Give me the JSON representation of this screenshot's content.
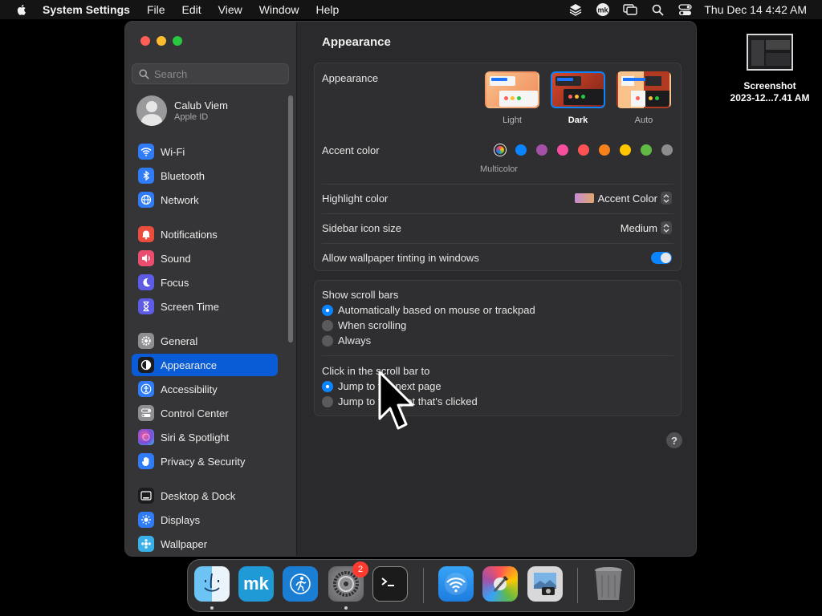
{
  "menubar": {
    "apple_icon": "apple-logo",
    "app_name": "System Settings",
    "items": [
      "File",
      "Edit",
      "View",
      "Window",
      "Help"
    ],
    "clock": "Thu Dec 14  4:42 AM",
    "status_icons": [
      "layers-icon",
      "mk-icon",
      "screen-mirroring-icon",
      "search-icon",
      "control-center-icon"
    ]
  },
  "desktop": {
    "file_name_line1": "Screenshot",
    "file_name_line2": "2023-12...7.41 AM"
  },
  "sidebar": {
    "search_placeholder": "Search",
    "user": {
      "name": "Calub Viem",
      "subtitle": "Apple ID"
    },
    "items": [
      {
        "label": "Wi-Fi",
        "icon": "wifi-icon",
        "color": "#2f7cf6"
      },
      {
        "label": "Bluetooth",
        "icon": "bluetooth-icon",
        "color": "#2f7cf6"
      },
      {
        "label": "Network",
        "icon": "globe-icon",
        "color": "#2f7cf6"
      },
      {
        "label": "Notifications",
        "icon": "bell-icon",
        "color": "#eb4d3d"
      },
      {
        "label": "Sound",
        "icon": "speaker-icon",
        "color": "#eb4d6e"
      },
      {
        "label": "Focus",
        "icon": "moon-icon",
        "color": "#5e5ce6"
      },
      {
        "label": "Screen Time",
        "icon": "hourglass-icon",
        "color": "#5e5ce6"
      },
      {
        "label": "General",
        "icon": "gear-icon",
        "color": "#8e8e93"
      },
      {
        "label": "Appearance",
        "icon": "appearance-icon",
        "color": "#1c1c1e"
      },
      {
        "label": "Accessibility",
        "icon": "accessibility-icon",
        "color": "#2f7cf6"
      },
      {
        "label": "Control Center",
        "icon": "control-center-icon",
        "color": "#8e8e93"
      },
      {
        "label": "Siri & Spotlight",
        "icon": "siri-icon",
        "color": "#7a4ddb"
      },
      {
        "label": "Privacy & Security",
        "icon": "hand-icon",
        "color": "#2f7cf6"
      },
      {
        "label": "Desktop & Dock",
        "icon": "dock-icon",
        "color": "#1c1c1e"
      },
      {
        "label": "Displays",
        "icon": "sun-icon",
        "color": "#2f7cf6"
      },
      {
        "label": "Wallpaper",
        "icon": "wallpaper-icon",
        "color": "#3ab0e8"
      }
    ],
    "selected": "Appearance"
  },
  "content": {
    "title": "Appearance",
    "appearance": {
      "label": "Appearance",
      "options": [
        "Light",
        "Dark",
        "Auto"
      ],
      "selected": "Dark"
    },
    "accent": {
      "label": "Accent color",
      "multicolor_label": "Multicolor",
      "colors": [
        "#ffffff",
        "#0a84ff",
        "#a550a7",
        "#f74f9e",
        "#ff5257",
        "#f7821b",
        "#ffc600",
        "#62ba46",
        "#8c8c8c"
      ]
    },
    "highlight": {
      "label": "Highlight color",
      "value": "Accent Color"
    },
    "sidebar_icon_size": {
      "label": "Sidebar icon size",
      "value": "Medium"
    },
    "wallpaper_tinting": {
      "label": "Allow wallpaper tinting in windows",
      "on": true
    },
    "scroll_bars": {
      "label": "Show scroll bars",
      "options": [
        "Automatically based on mouse or trackpad",
        "When scrolling",
        "Always"
      ],
      "selected": 0
    },
    "click_scroll": {
      "label": "Click in the scroll bar to",
      "options": [
        "Jump to the next page",
        "Jump to the spot that's clicked"
      ],
      "selected": 0
    },
    "help_label": "?"
  },
  "dock": {
    "apps": [
      {
        "name": "Finder",
        "icon": "finder-icon",
        "running": true
      },
      {
        "name": "mk",
        "icon": "mk-app-icon",
        "running": false
      },
      {
        "name": "Fitness",
        "icon": "runner-icon",
        "running": false
      },
      {
        "name": "System Settings",
        "icon": "settings-gear-icon",
        "running": true,
        "badge": "2"
      },
      {
        "name": "Terminal",
        "icon": "terminal-icon",
        "running": false
      },
      {
        "name": "Wireless Diagnostics",
        "icon": "wifi-app-icon",
        "running": false
      },
      {
        "name": "ColorSync Utility",
        "icon": "colorsync-icon",
        "running": false
      },
      {
        "name": "Preview",
        "icon": "preview-icon",
        "running": false
      },
      {
        "name": "Trash",
        "icon": "trash-icon",
        "running": false
      }
    ]
  }
}
